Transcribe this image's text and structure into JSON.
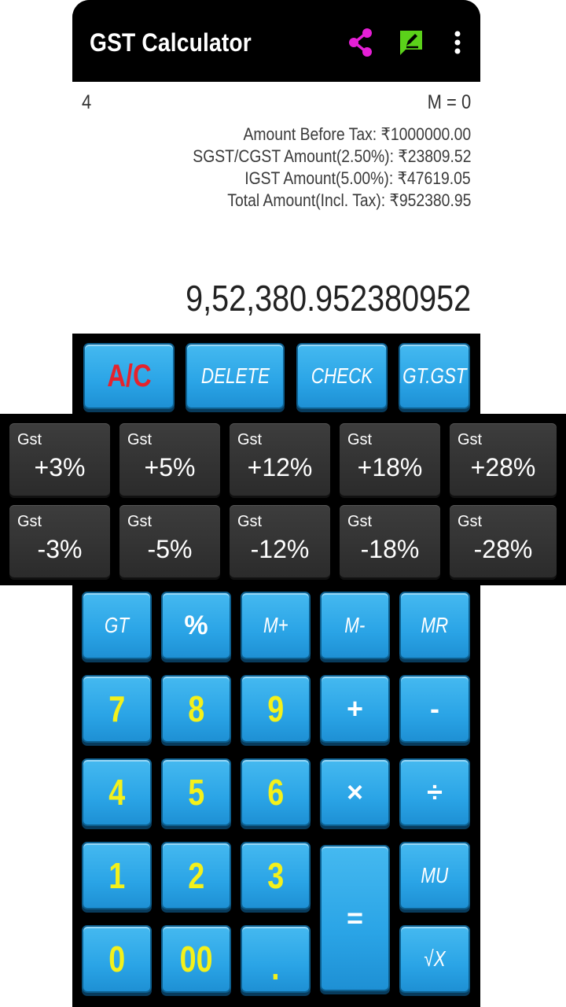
{
  "toolbar": {
    "title": "GST Calculator",
    "share_icon": "share-icon",
    "edit_icon": "edit-icon",
    "more_icon": "more-vert-icon",
    "colors": {
      "share": "#e61fd6",
      "edit": "#5bd11a"
    }
  },
  "display": {
    "grand_total": "4",
    "memory": "M = 0",
    "summary": [
      "Amount Before Tax: ₹1000000.00",
      "SGST/CGST Amount(2.50%): ₹23809.52",
      "IGST Amount(5.00%): ₹47619.05",
      "Total Amount(Incl. Tax): ₹952380.95"
    ],
    "result": "9,52,380.952380952"
  },
  "top_buttons": [
    "A/C",
    "DELETE",
    "CHECK",
    "GT.GST"
  ],
  "gst_label": "Gst",
  "gst_plus": [
    "+3%",
    "+5%",
    "+12%",
    "+18%",
    "+28%"
  ],
  "gst_minus": [
    "-3%",
    "-5%",
    "-12%",
    "-18%",
    "-28%"
  ],
  "keys": {
    "gt": "GT",
    "percent": "%",
    "mplus": "M+",
    "mminus": "M-",
    "mr": "MR",
    "d7": "7",
    "d8": "8",
    "d9": "9",
    "plus": "+",
    "minus": "-",
    "d4": "4",
    "d5": "5",
    "d6": "6",
    "times": "×",
    "divide": "÷",
    "d1": "1",
    "d2": "2",
    "d3": "3",
    "equals": "=",
    "mu": "MU",
    "d0": "0",
    "d00": "00",
    "dot": ".",
    "sqrt": "√X"
  },
  "colors": {
    "key_blue": "#2aa4e6",
    "digit_yellow": "#f4f11a",
    "ac_red": "#e5232d",
    "gst_dark": "#333333"
  }
}
